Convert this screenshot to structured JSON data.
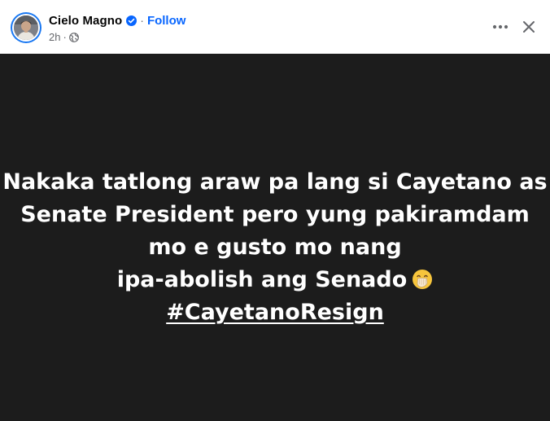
{
  "author": {
    "name": "Cielo Magno",
    "follow_label": "Follow",
    "separator": "·",
    "verified": true
  },
  "meta": {
    "timestamp": "2h",
    "separator": "·",
    "audience_icon": "globe-icon"
  },
  "actions": {
    "more_icon": "more-options-icon",
    "close_icon": "close-icon"
  },
  "post": {
    "background": "#1c1c1c",
    "text_color": "#ffffff",
    "lines": [
      "Nakaka tatlong araw pa lang si Cayetano as",
      "Senate President pero yung pakiramdam",
      "mo e gusto mo nang",
      "ipa-abolish ang Senado"
    ],
    "emoji": "face-with-hand-over-mouth-emoji",
    "hashtag": "#CayetanoResign"
  },
  "colors": {
    "accent": "#0866ff",
    "verified": "#0866ff",
    "secondary_text": "#65676b"
  }
}
